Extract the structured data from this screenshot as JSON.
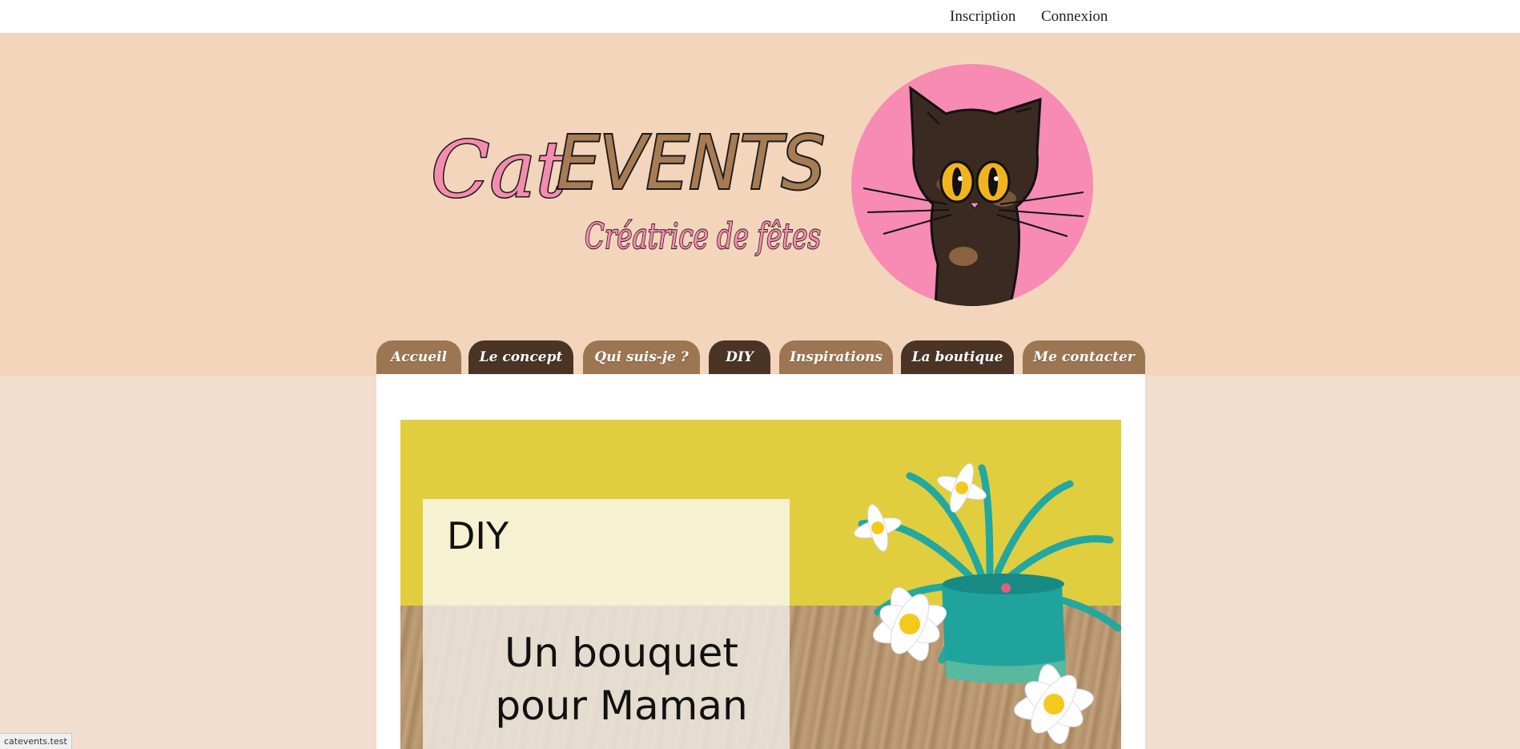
{
  "topbar": {
    "signup": "Inscription",
    "login": "Connexion"
  },
  "logo": {
    "brand_cat": "Cat",
    "brand_events": "EVENTS",
    "tagline": "Créatrice de fêtes"
  },
  "nav": {
    "items": [
      {
        "label": "Accueil",
        "style": "light"
      },
      {
        "label": "Le concept",
        "style": "dark"
      },
      {
        "label": "Qui suis-je ?",
        "style": "light"
      },
      {
        "label": "DIY",
        "style": "dark"
      },
      {
        "label": "Inspirations",
        "style": "light"
      },
      {
        "label": "La boutique",
        "style": "dark"
      },
      {
        "label": "Me contacter",
        "style": "light"
      }
    ]
  },
  "hero": {
    "category": "DIY",
    "title_line1": "Un bouquet",
    "title_line2": "pour Maman"
  },
  "status": {
    "url": "catevents.test"
  },
  "colors": {
    "header_bg": "#f3d5bb",
    "page_bg": "#f2dece",
    "tab_light": "#9c7652",
    "tab_dark": "#4a3426",
    "avatar_bg": "#f78bb3",
    "logo_pink": "#f48cb0",
    "logo_brown": "#a77b54"
  }
}
